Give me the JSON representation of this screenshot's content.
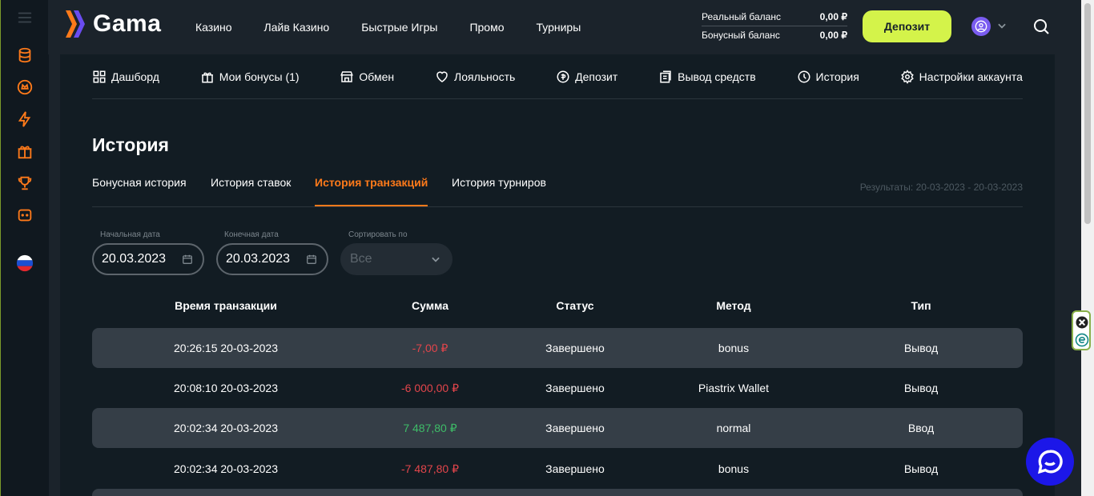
{
  "header": {
    "logo_text": "Gama",
    "nav": [
      "Казино",
      "Лайв Казино",
      "Быстрые Игры",
      "Промо",
      "Турниры"
    ],
    "real_balance_label": "Реальный баланс",
    "real_balance_value": "0,00 ₽",
    "bonus_balance_label": "Бонусный баланс",
    "bonus_balance_value": "0,00 ₽",
    "deposit_label": "Депозит"
  },
  "account_nav": [
    {
      "label": "Дашборд",
      "icon": "dashboard-icon"
    },
    {
      "label": "Мои бонусы (1)",
      "icon": "gift-icon"
    },
    {
      "label": "Обмен",
      "icon": "shop-icon"
    },
    {
      "label": "Лояльность",
      "icon": "heart-icon"
    },
    {
      "label": "Депозит",
      "icon": "coin-icon"
    },
    {
      "label": "Вывод средств",
      "icon": "withdraw-icon"
    },
    {
      "label": "История",
      "icon": "history-icon"
    },
    {
      "label": "Настройки аккаунта",
      "icon": "settings-icon"
    }
  ],
  "page": {
    "title": "История",
    "tabs": [
      "Бонусная история",
      "История ставок",
      "История транзакций",
      "История турниров"
    ],
    "active_tab": "История транзакций",
    "results": "Результаты: 20-03-2023 - 20-03-2023"
  },
  "filters": {
    "start_label": "Начальная дата",
    "start_value": "20.03.2023",
    "end_label": "Конечная дата",
    "end_value": "20.03.2023",
    "sort_label": "Сортировать по",
    "sort_value": "Все"
  },
  "table": {
    "headers": [
      "Время транзакции",
      "Сумма",
      "Статус",
      "Метод",
      "Тип"
    ],
    "rows": [
      [
        "20:26:15 20-03-2023",
        "-7,00 ₽",
        "Завершено",
        "bonus",
        "Вывод"
      ],
      [
        "20:08:10 20-03-2023",
        "-6 000,00 ₽",
        "Завершено",
        "Piastrix Wallet",
        "Вывод"
      ],
      [
        "20:02:34 20-03-2023",
        "7 487,80 ₽",
        "Завершено",
        "normal",
        "Ввод"
      ],
      [
        "20:02:34 20-03-2023",
        "-7 487,80 ₽",
        "Завершено",
        "bonus",
        "Вывод"
      ]
    ]
  },
  "colors": {
    "accent": "#ff7a1a",
    "deposit": "#d4f34a",
    "negative": "#e3454b",
    "positive": "#3ebd68"
  }
}
